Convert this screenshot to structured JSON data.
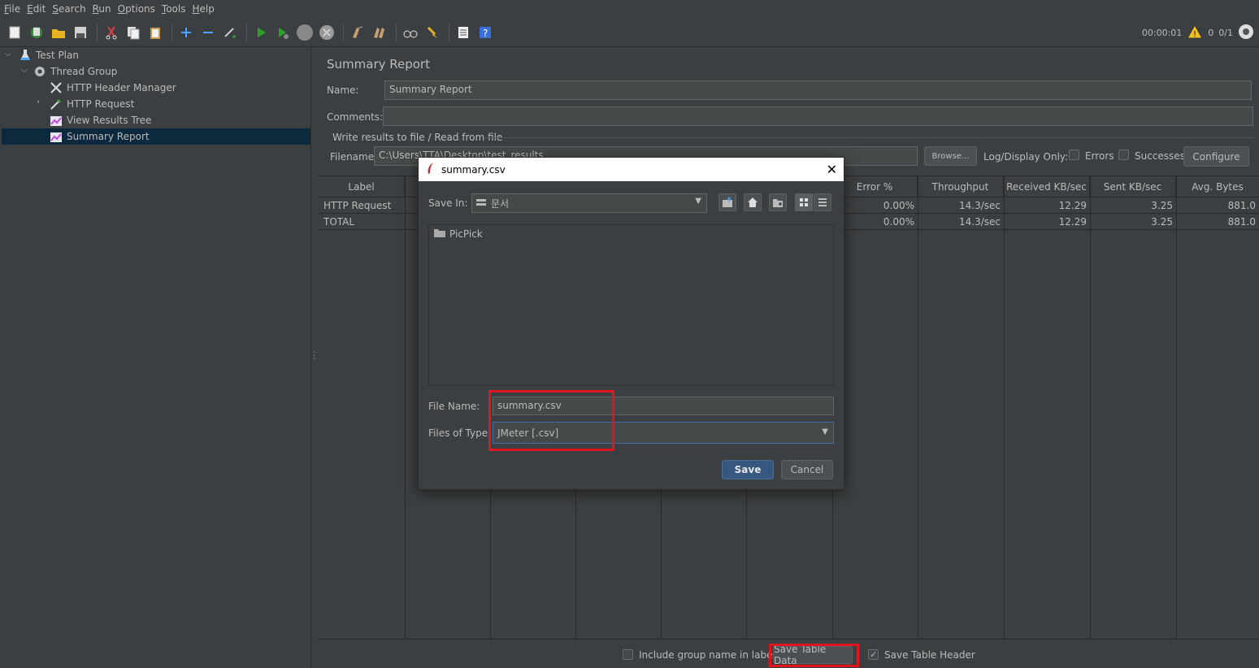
{
  "menu": [
    {
      "label": "File",
      "u": "F",
      "rest": "ile"
    },
    {
      "label": "Edit",
      "u": "E",
      "rest": "dit"
    },
    {
      "label": "Search",
      "u": "S",
      "rest": "earch"
    },
    {
      "label": "Run",
      "u": "R",
      "rest": "un"
    },
    {
      "label": "Options",
      "u": "O",
      "rest": "ptions"
    },
    {
      "label": "Tools",
      "u": "T",
      "rest": "ools"
    },
    {
      "label": "Help",
      "u": "H",
      "rest": "elp"
    }
  ],
  "toolbar": {
    "timer": "00:00:01",
    "warnings": "0",
    "threads": "0/1"
  },
  "tree": {
    "items": [
      {
        "label": "Test Plan",
        "icon": "flask-icon"
      },
      {
        "label": "Thread Group",
        "icon": "gear-icon"
      },
      {
        "label": "HTTP Header Manager",
        "icon": "wrench-icon"
      },
      {
        "label": "HTTP Request",
        "icon": "pipette-icon"
      },
      {
        "label": "View Results Tree",
        "icon": "chart-icon"
      },
      {
        "label": "Summary Report",
        "icon": "chart-icon"
      }
    ]
  },
  "panel": {
    "title": "Summary Report",
    "name_label": "Name:",
    "name_value": "Summary Report",
    "comments_label": "Comments:",
    "comments_value": "",
    "write_results_label": "Write results to file / Read from file",
    "filename_label": "Filename",
    "filename_value": "C:\\Users\\TTA\\Desktop\\test_results",
    "browse_label": "Browse...",
    "log_display_label": "Log/Display Only:",
    "errors_label": "Errors",
    "successes_label": "Successes",
    "configure_label": "Configure"
  },
  "table": {
    "columns": [
      "Label",
      "",
      "",
      "",
      "",
      "",
      "Error %",
      "Throughput",
      "Received KB/sec",
      "Sent KB/sec",
      "Avg. Bytes"
    ],
    "rows": [
      {
        "label": "HTTP Request",
        "error": "0.00%",
        "throughput": "14.3/sec",
        "received": "12.29",
        "sent": "3.25",
        "avg_bytes": "881.0"
      },
      {
        "label": "TOTAL",
        "error": "0.00%",
        "throughput": "14.3/sec",
        "received": "12.29",
        "sent": "3.25",
        "avg_bytes": "881.0"
      }
    ]
  },
  "bottom": {
    "include_group_label": "Include group name in label?",
    "save_table_data": "Save Table Data",
    "save_table_header": "Save Table Header"
  },
  "dialog": {
    "title": "summary.csv",
    "save_in_label": "Save In:",
    "save_in_value": "문서",
    "folder_name": "PicPick",
    "file_name_label": "File Name:",
    "file_name_value": "summary.csv",
    "files_of_type_label": "Files of Type:",
    "files_of_type_value": "JMeter [.csv]",
    "save_label": "Save",
    "cancel_label": "Cancel"
  },
  "colors": {
    "background": "#3c3f41",
    "selection": "#0d293e",
    "highlight_box": "#e0161e",
    "primary_button": "#365880"
  }
}
